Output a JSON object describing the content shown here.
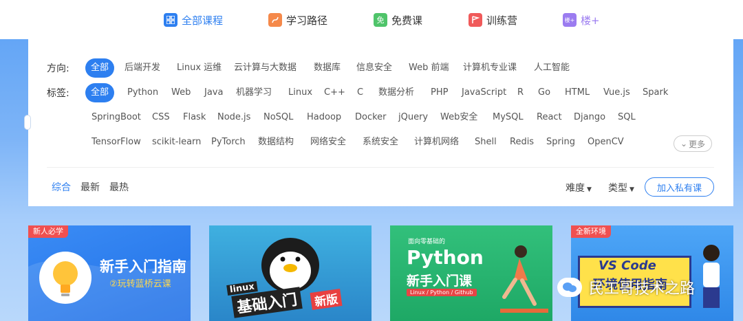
{
  "topnav": {
    "items": [
      {
        "label": "全部课程",
        "icon": "grid-icon",
        "color": "#2d7ff0"
      },
      {
        "label": "学习路径",
        "icon": "path-icon",
        "color": "#f5894a"
      },
      {
        "label": "免费课",
        "icon": "free-icon",
        "glyph": "免",
        "color": "#4fc46a"
      },
      {
        "label": "训练营",
        "icon": "flag-icon",
        "color": "#f05a5a"
      },
      {
        "label": "楼+",
        "icon": "lou-icon",
        "glyph": "楼+",
        "color": "#9b7cf0"
      }
    ]
  },
  "filters": {
    "direction_label": "方向:",
    "directions": [
      "全部",
      "后端开发",
      "Linux 运维",
      "云计算与大数据",
      "数据库",
      "信息安全",
      "Web 前端",
      "计算机专业课",
      "人工智能"
    ],
    "tags_label": "标签:",
    "tags_row1": [
      "全部",
      "Python",
      "Web",
      "Java",
      "机器学习",
      "Linux",
      "C++",
      "C",
      "数据分析",
      "PHP",
      "JavaScript",
      "R",
      "Go",
      "HTML",
      "Vue.js",
      "Spark"
    ],
    "tags_row2": [
      "SpringBoot",
      "CSS",
      "Flask",
      "Node.js",
      "NoSQL",
      "Hadoop",
      "Docker",
      "jQuery",
      "Web安全",
      "MySQL",
      "React",
      "Django",
      "SQL"
    ],
    "tags_row3": [
      "TensorFlow",
      "scikit-learn",
      "PyTorch",
      "数据结构",
      "网络安全",
      "系统安全",
      "计算机网络",
      "Shell",
      "Redis",
      "Spring",
      "OpenCV"
    ],
    "more_label": "更多"
  },
  "sorting": {
    "options": [
      "综合",
      "最新",
      "最热"
    ],
    "difficulty": "难度",
    "type": "类型",
    "join_button": "加入私有课"
  },
  "cards": [
    {
      "badge": "新人必学",
      "title": "新手入门指南",
      "subtitle": "②玩转蓝桥云课"
    },
    {
      "line1": "linux",
      "line2": "基础入门",
      "line3": "新版"
    },
    {
      "small": "面向零基础的",
      "title": "Python",
      "subtitle": "新手入门课",
      "tag": "Linux / Python / Github"
    },
    {
      "badge": "全新环境",
      "title": "VS Code",
      "subtitle": "环境使用指南"
    }
  ],
  "watermark": "民工哥技术之路"
}
